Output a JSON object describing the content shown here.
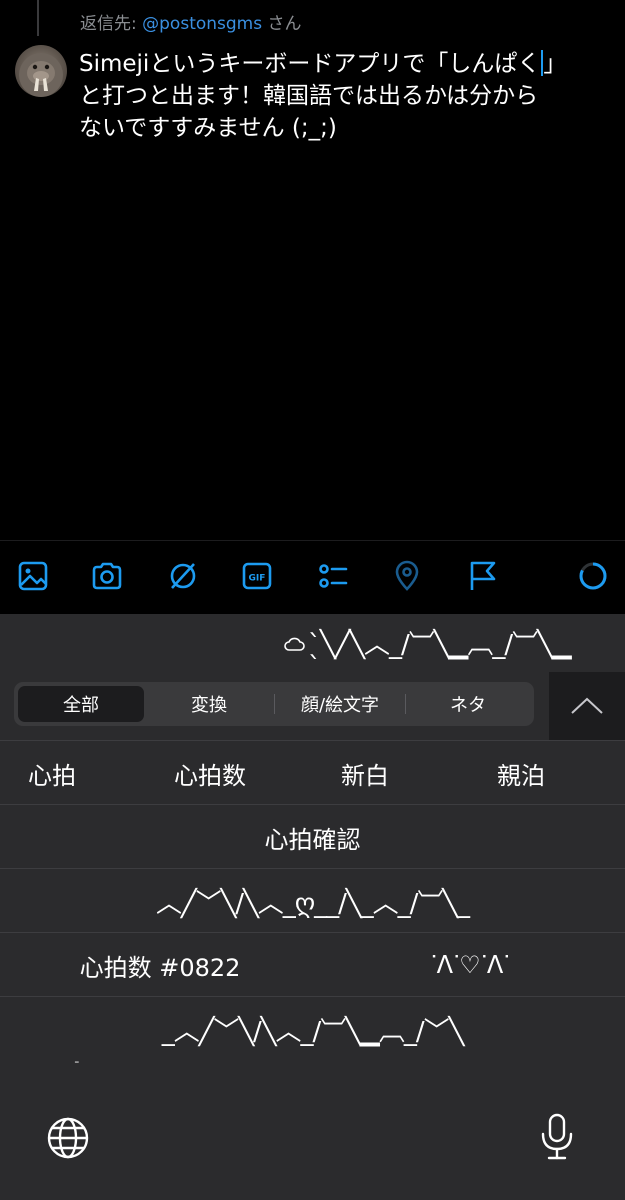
{
  "reply": {
    "prefix": "返信先: ",
    "handle": "@postonsgms",
    "suffix": " さん"
  },
  "tweet": {
    "lines": [
      "Simejiというキーボードアプリで「しんぱく",
      "と打つと出ます！韓国語では出るかは分から",
      "ないですすみません (;_;)"
    ],
    "line1_close": "」"
  },
  "toolbar": {
    "icons": [
      "image-icon",
      "camera-icon",
      "no-sign-icon",
      "gif-icon",
      "poll-icon",
      "location-icon",
      "flag-icon",
      "progress-ring-icon"
    ],
    "accent": "#1d9bf0",
    "gif_label": "GIF"
  },
  "keyboard": {
    "preview": "ˎ̀╲╱╲︿_/︺╲▁︹_/︺╲▁",
    "tabs": [
      "全部",
      "変換",
      "顔/絵文字",
      "ネタ"
    ],
    "active_tab": "全部",
    "rows": [
      [
        "心拍",
        "心拍数",
        "新白",
        "親泊"
      ],
      [
        "心拍確認"
      ],
      [
        "︿╱﹀╲/╲︿_ღ__/╲_︿_/︺╲_"
      ],
      [
        "心拍数 #0822",
        "ᐝᐱᐝ♡ᐝᐱᐝ"
      ],
      [
        "_︿╱﹀╲/╲︿_/︺╲▁︹_/﹀╲"
      ]
    ],
    "partial_glyph": "ᐨ"
  }
}
